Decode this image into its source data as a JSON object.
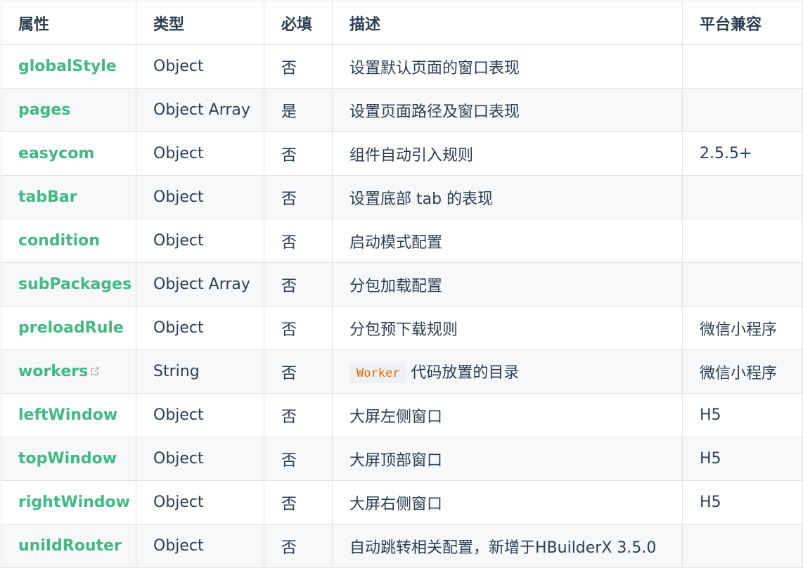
{
  "headers": {
    "attr": "属性",
    "type": "类型",
    "required": "必填",
    "desc": "描述",
    "platform": "平台兼容"
  },
  "rows": [
    {
      "name": "globalStyle",
      "type": "Object",
      "required": "否",
      "desc": "设置默认页面的窗口表现",
      "platform": ""
    },
    {
      "name": "pages",
      "type": "Object Array",
      "required": "是",
      "desc": "设置页面路径及窗口表现",
      "platform": ""
    },
    {
      "name": "easycom",
      "type": "Object",
      "required": "否",
      "desc": "组件自动引入规则",
      "platform": "2.5.5+"
    },
    {
      "name": "tabBar",
      "type": "Object",
      "required": "否",
      "desc": "设置底部 tab 的表现",
      "platform": ""
    },
    {
      "name": "condition",
      "type": "Object",
      "required": "否",
      "desc": "启动模式配置",
      "platform": ""
    },
    {
      "name": "subPackages",
      "type": "Object Array",
      "required": "否",
      "desc": "分包加载配置",
      "platform": ""
    },
    {
      "name": "preloadRule",
      "type": "Object",
      "required": "否",
      "desc": "分包预下载规则",
      "platform": "微信小程序"
    },
    {
      "name": "workers",
      "type": "String",
      "required": "否",
      "desc_code": "Worker",
      "desc": "代码放置的目录",
      "platform": "微信小程序"
    },
    {
      "name": "leftWindow",
      "type": "Object",
      "required": "否",
      "desc": "大屏左侧窗口",
      "platform": "H5"
    },
    {
      "name": "topWindow",
      "type": "Object",
      "required": "否",
      "desc": "大屏顶部窗口",
      "platform": "H5"
    },
    {
      "name": "rightWindow",
      "type": "Object",
      "required": "否",
      "desc": "大屏右侧窗口",
      "platform": "H5"
    },
    {
      "name": "uniIdRouter",
      "type": "Object",
      "required": "否",
      "desc": "自动跳转相关配置，新增于HBuilderX 3.5.0",
      "platform": ""
    }
  ],
  "colors": {
    "accent": "#42b983",
    "text": "#2c3e50",
    "code": "#e96900",
    "stripe": "#f6f8fa",
    "border": "#dfe2e5"
  },
  "icons": {
    "external_link": "external-link-icon"
  }
}
